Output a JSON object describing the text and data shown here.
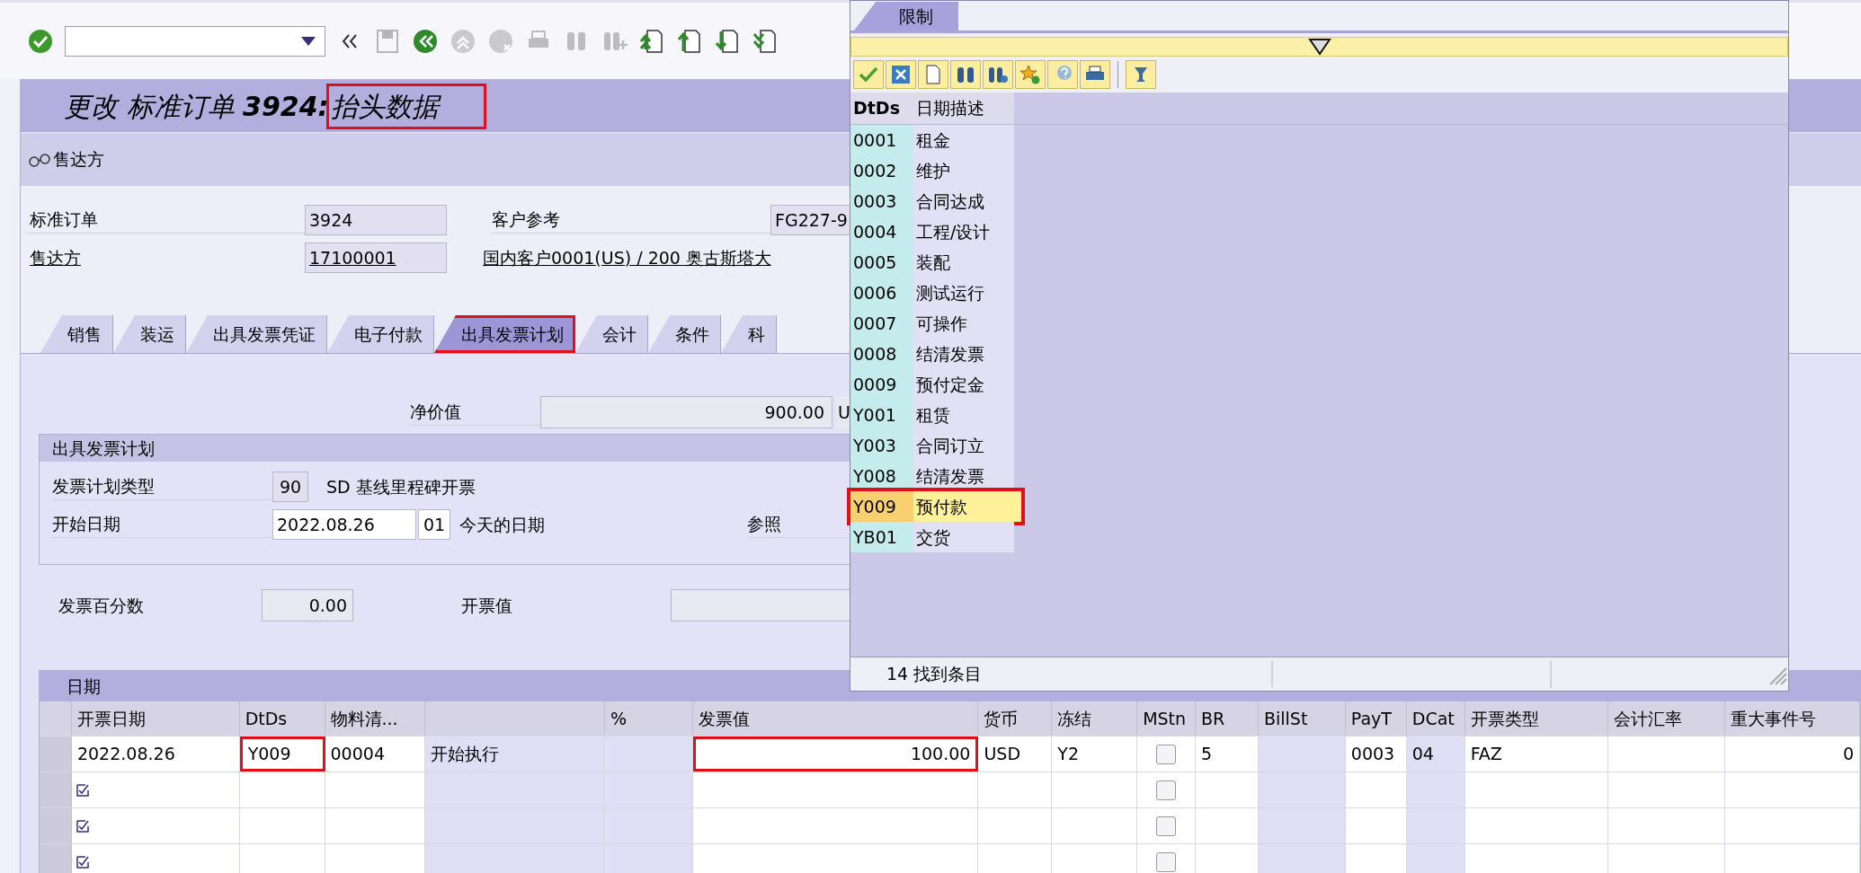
{
  "title": {
    "main": "更改 标准订单 **3924:**",
    "suffix": "抬头数据",
    "suffix_highlighted": true
  },
  "subtoolbar": {
    "button": "售达方"
  },
  "header": {
    "order_label": "标准订单",
    "order_value": "3924",
    "ref_label": "客户参考",
    "ref_value": "FG227-9",
    "party_label": "售达方",
    "party_value": "17100001",
    "party_desc": "国内客户0001(US) / 200 奥古斯塔大"
  },
  "tabs": [
    {
      "label": "销售",
      "selected": false,
      "highlighted": false
    },
    {
      "label": "装运",
      "selected": false,
      "highlighted": false
    },
    {
      "label": "出具发票凭证",
      "selected": false,
      "highlighted": false
    },
    {
      "label": "电子付款",
      "selected": false,
      "highlighted": false
    },
    {
      "label": "出具发票计划",
      "selected": true,
      "highlighted": true
    },
    {
      "label": "会计",
      "selected": false,
      "highlighted": false
    },
    {
      "label": "条件",
      "selected": false,
      "highlighted": false
    },
    {
      "label": "科",
      "selected": false,
      "highlighted": false
    }
  ],
  "net_value": {
    "label": "净价值",
    "value": "900.00",
    "currency": "U"
  },
  "plan": {
    "title": "出具发票计划",
    "type_label": "发票计划类型",
    "type_value": "90",
    "type_desc": "SD 基线里程碑开票",
    "start_label": "开始日期",
    "start_date": "2022.08.26",
    "start_rule": "01",
    "start_desc": "今天的日期",
    "ref_label": "参照"
  },
  "percent": {
    "label": "发票百分数",
    "value": "0.00",
    "amount_label": "开票值"
  },
  "dates": {
    "title": "日期",
    "columns": [
      "开票日期",
      "DtDs",
      "物料清...",
      "",
      "%",
      "发票值",
      "货币",
      "冻结",
      "MStn",
      "BR",
      "BillSt",
      "PayT",
      "DCat",
      "开票类型",
      "会计汇率",
      "重大事件号"
    ],
    "rows": [
      {
        "kind": "entry",
        "cells": [
          "2022.08.26",
          "Y009",
          "00004",
          "开始执行",
          "",
          "100.00",
          "USD",
          "Y2",
          "",
          "5",
          "",
          "0003",
          "04",
          "FAZ",
          "",
          "0"
        ],
        "highlighted": [
          false,
          true,
          false,
          false,
          false,
          true,
          false,
          false,
          false,
          false,
          false,
          false,
          false,
          false,
          false,
          false
        ],
        "mstn_checked": false
      },
      {
        "kind": "new",
        "mstn_checked": false
      },
      {
        "kind": "new",
        "mstn_checked": false
      },
      {
        "kind": "new",
        "mstn_checked": false
      }
    ]
  },
  "popup": {
    "tab": "限制",
    "columns": [
      "DtDs",
      "日期描述"
    ],
    "items": [
      {
        "code": "0001",
        "desc": "租金",
        "selected": false
      },
      {
        "code": "0002",
        "desc": "维护",
        "selected": false
      },
      {
        "code": "0003",
        "desc": "合同达成",
        "selected": false
      },
      {
        "code": "0004",
        "desc": "工程/设计",
        "selected": false
      },
      {
        "code": "0005",
        "desc": "装配",
        "selected": false
      },
      {
        "code": "0006",
        "desc": "测试运行",
        "selected": false
      },
      {
        "code": "0007",
        "desc": "可操作",
        "selected": false
      },
      {
        "code": "0008",
        "desc": "结清发票",
        "selected": false
      },
      {
        "code": "0009",
        "desc": "预付定金",
        "selected": false
      },
      {
        "code": "Y001",
        "desc": "租赁",
        "selected": false
      },
      {
        "code": "Y003",
        "desc": "合同订立",
        "selected": false
      },
      {
        "code": "Y008",
        "desc": "结清发票",
        "selected": false
      },
      {
        "code": "Y009",
        "desc": "预付款",
        "selected": true
      },
      {
        "code": "YB01",
        "desc": "交货",
        "selected": false
      }
    ],
    "status": "14 找到条目"
  }
}
